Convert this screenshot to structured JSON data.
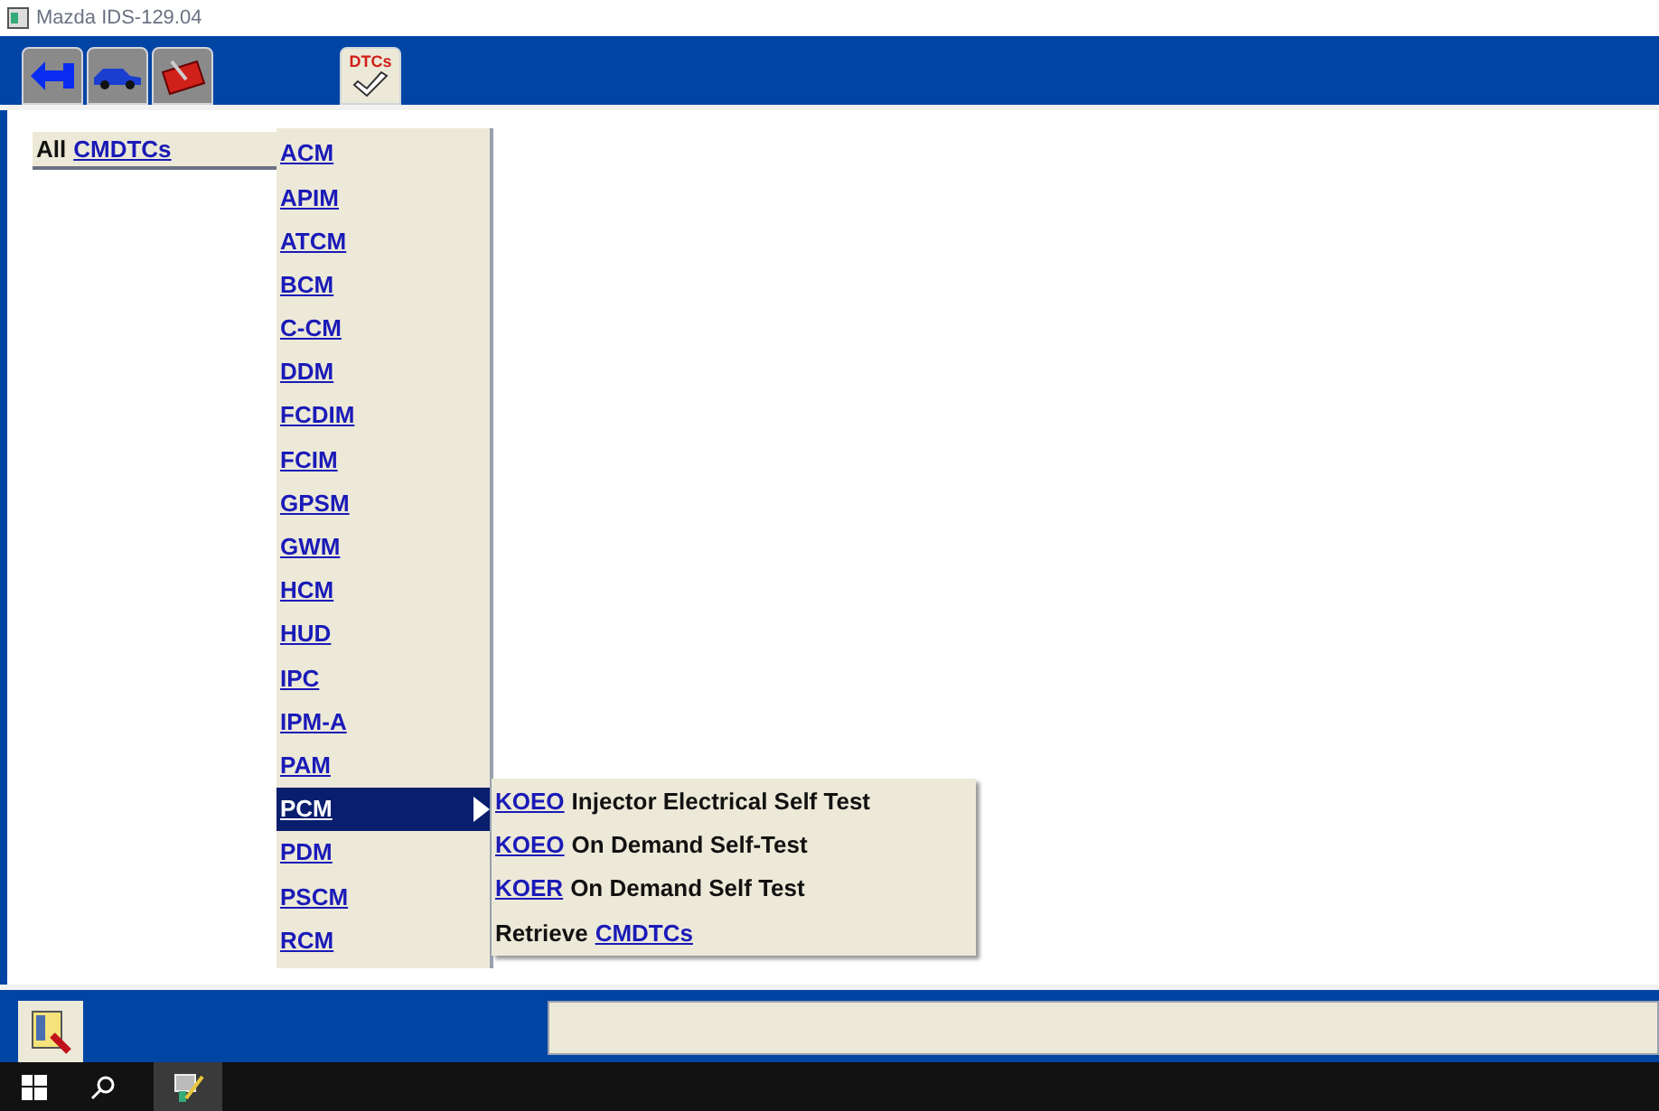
{
  "window": {
    "title": "Mazda IDS-129.04"
  },
  "toolbar_tabs": [
    {
      "kind": "connector",
      "selected": false
    },
    {
      "kind": "vehicle",
      "selected": false
    },
    {
      "kind": "toolbox",
      "selected": false
    },
    {
      "kind": "dtcs",
      "label": "DTCs",
      "selected": true
    }
  ],
  "breadcrumb": [
    {
      "kind": "text",
      "text": "All"
    },
    {
      "kind": "link",
      "text": "CMDTCs"
    }
  ],
  "modules": [
    {
      "label": "ACM",
      "selected": false
    },
    {
      "label": "APIM",
      "selected": false
    },
    {
      "label": "ATCM",
      "selected": false
    },
    {
      "label": "BCM",
      "selected": false
    },
    {
      "label": "C-CM",
      "selected": false
    },
    {
      "label": "DDM",
      "selected": false
    },
    {
      "label": "FCDIM",
      "selected": false
    },
    {
      "label": "FCIM",
      "selected": false
    },
    {
      "label": "GPSM",
      "selected": false
    },
    {
      "label": "GWM",
      "selected": false
    },
    {
      "label": "HCM",
      "selected": false
    },
    {
      "label": "HUD",
      "selected": false
    },
    {
      "label": "IPC",
      "selected": false
    },
    {
      "label": "IPM-A",
      "selected": false
    },
    {
      "label": "PAM",
      "selected": false
    },
    {
      "label": "PCM",
      "selected": true
    },
    {
      "label": "PDM",
      "selected": false
    },
    {
      "label": "PSCM",
      "selected": false
    },
    {
      "label": "RCM",
      "selected": false
    }
  ],
  "submenu": [
    {
      "parts": [
        {
          "kind": "link",
          "text": "KOEO"
        },
        {
          "kind": "text",
          "text": "Injector Electrical Self Test"
        }
      ]
    },
    {
      "parts": [
        {
          "kind": "link",
          "text": "KOEO"
        },
        {
          "kind": "text",
          "text": "On Demand Self-Test"
        }
      ]
    },
    {
      "parts": [
        {
          "kind": "link",
          "text": "KOER"
        },
        {
          "kind": "text",
          "text": "On Demand Self Test"
        }
      ]
    },
    {
      "parts": [
        {
          "kind": "text",
          "text": "Retrieve"
        },
        {
          "kind": "link",
          "text": "CMDTCs"
        }
      ]
    }
  ]
}
